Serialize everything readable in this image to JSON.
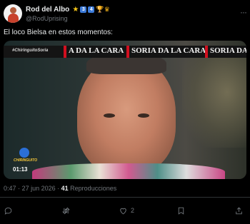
{
  "author": {
    "display_name": "Rod del Albo",
    "handle": "@RodUprising",
    "badges": [
      {
        "name": "star-icon",
        "glyph": "★"
      },
      {
        "name": "number-3-icon",
        "glyph": "3"
      },
      {
        "name": "number-4-icon",
        "glyph": "4"
      },
      {
        "name": "trophy-icon",
        "glyph": "🏆"
      },
      {
        "name": "crown-icon",
        "glyph": "♛"
      }
    ]
  },
  "tweet": {
    "text": "El loco Bielsa en estos momentos:"
  },
  "media": {
    "ticker_tag": "#ChiringuitoSoria",
    "ticker_items": [
      "A DA LA CARA",
      "SORIA DA LA CARA",
      "SORIA DA"
    ],
    "logo_text": "CHIRINGUITO",
    "timecode": "01:13",
    "accent_color": "#d10f1f"
  },
  "meta": {
    "time": "0:47",
    "date": "27 jun 2026",
    "separator": "·",
    "views": "41",
    "views_label": "Reproducciones"
  },
  "actions": {
    "reply_count": "",
    "retweet_count": "",
    "like_count": "2",
    "bookmark_count": "",
    "share_count": ""
  },
  "colors": {
    "background": "#000000",
    "text_primary": "#e7e9ea",
    "text_secondary": "#71767b",
    "divider": "#2f3336"
  }
}
